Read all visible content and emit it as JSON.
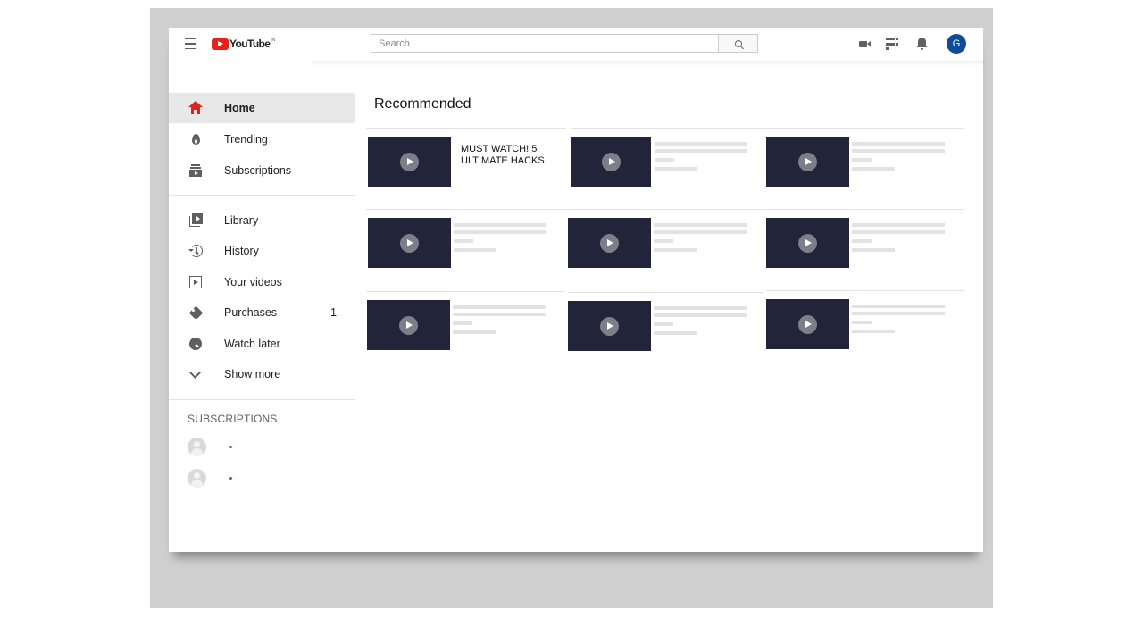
{
  "header": {
    "logo_text": "YouTube",
    "logo_region": "IN",
    "search_placeholder": "Search",
    "avatar_initial": "G",
    "avatar_color": "#0f4c9a",
    "brand_color": "#e62117"
  },
  "sidebar": {
    "primary": [
      {
        "label": "Home",
        "icon": "home-icon",
        "active": true
      },
      {
        "label": "Trending",
        "icon": "flame-icon"
      },
      {
        "label": "Subscriptions",
        "icon": "subscriptions-icon"
      }
    ],
    "library": [
      {
        "label": "Library",
        "icon": "library-icon"
      },
      {
        "label": "History",
        "icon": "history-icon"
      },
      {
        "label": "Your videos",
        "icon": "your-videos-icon"
      },
      {
        "label": "Purchases",
        "icon": "tag-icon",
        "badge": "1"
      },
      {
        "label": "Watch later",
        "icon": "clock-icon"
      },
      {
        "label": "Show more",
        "icon": "chevron-down-icon"
      }
    ],
    "subscriptions_heading": "SUBSCRIPTIONS",
    "subscriptions": [
      {
        "icon": "channel-avatar-icon",
        "new_indicator": true
      },
      {
        "icon": "channel-avatar-icon",
        "new_indicator": true
      }
    ]
  },
  "main": {
    "section_title": "Recommended",
    "videos": [
      {
        "title": "MUST WATCH! 5 ULTIMATE HACKS",
        "icon": "play-icon"
      },
      {
        "title": "",
        "icon": "play-icon"
      },
      {
        "title": "",
        "icon": "play-icon"
      },
      {
        "title": "",
        "icon": "play-icon"
      },
      {
        "title": "",
        "icon": "play-icon"
      },
      {
        "title": "",
        "icon": "play-icon"
      },
      {
        "title": "",
        "icon": "play-icon"
      },
      {
        "title": "",
        "icon": "play-icon"
      },
      {
        "title": "",
        "icon": "play-icon"
      }
    ]
  }
}
